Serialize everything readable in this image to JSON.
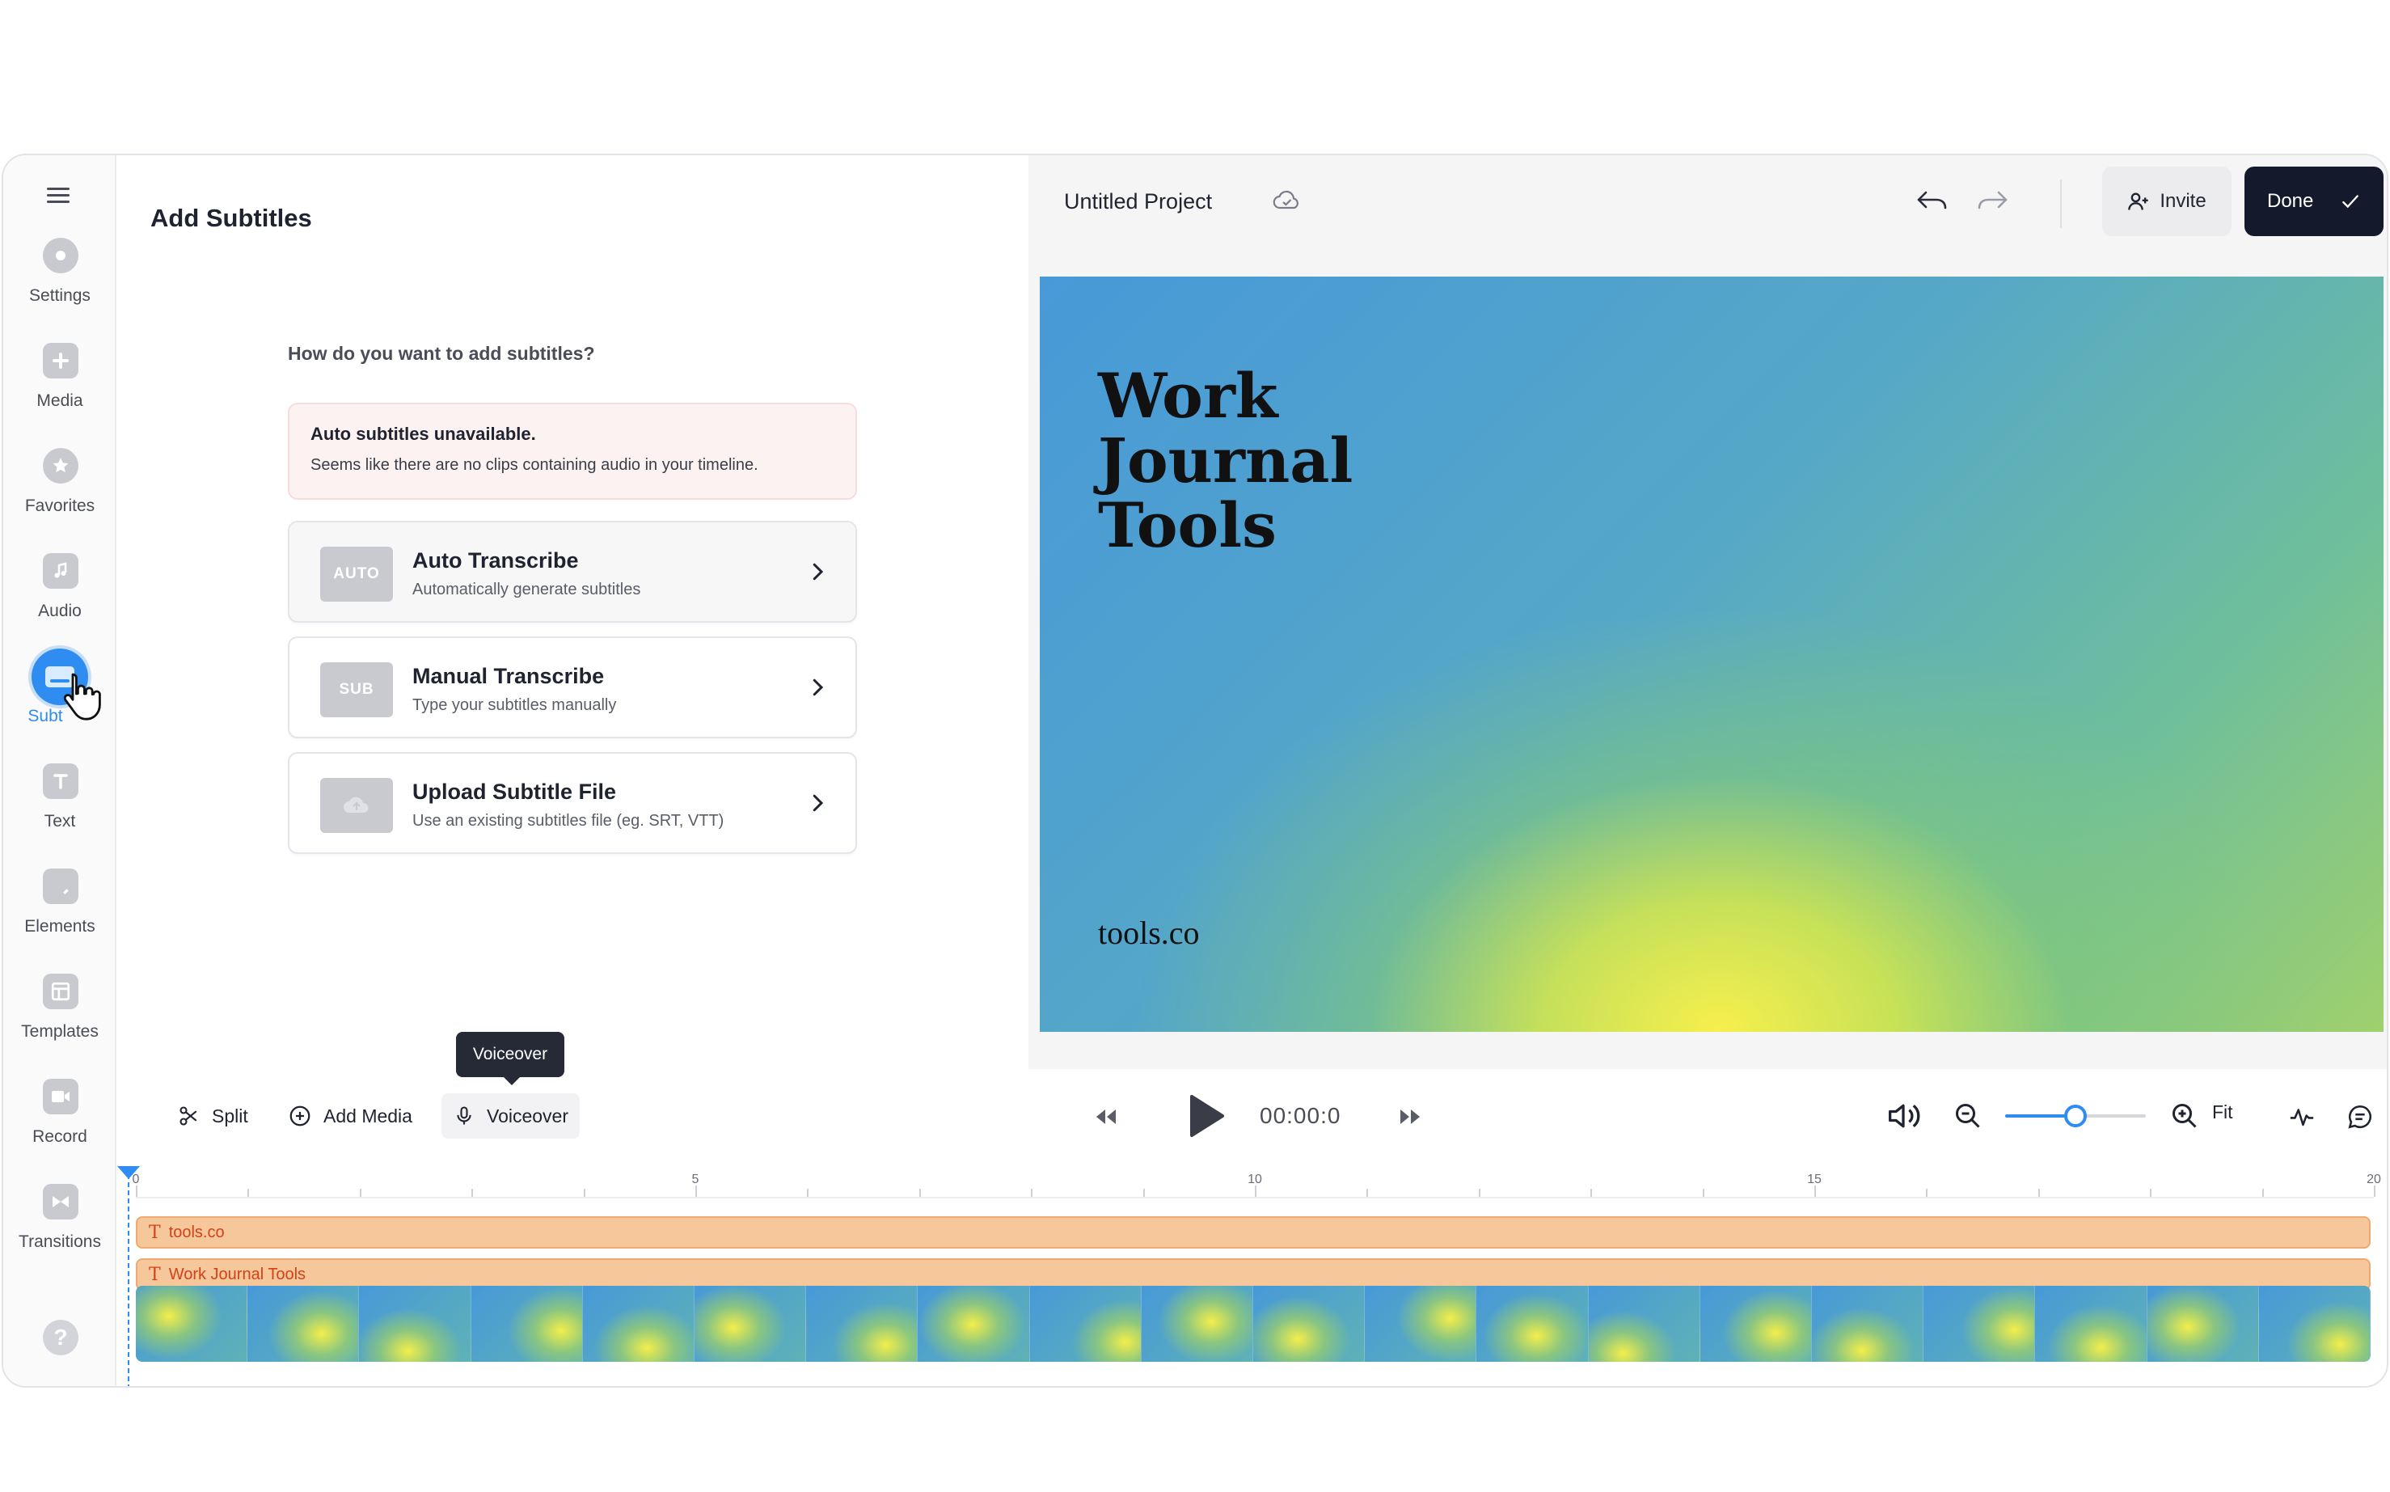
{
  "rail": {
    "items": [
      {
        "label": "Settings",
        "icon": "gear-icon"
      },
      {
        "label": "Media",
        "icon": "plus-icon"
      },
      {
        "label": "Favorites",
        "icon": "star-icon"
      },
      {
        "label": "Audio",
        "icon": "music-note-icon"
      },
      {
        "label": "Subtitles",
        "icon": "subtitles-icon"
      },
      {
        "label": "Text",
        "icon": "text-icon"
      },
      {
        "label": "Elements",
        "icon": "sticker-icon"
      },
      {
        "label": "Templates",
        "icon": "template-icon"
      },
      {
        "label": "Record",
        "icon": "camera-icon"
      },
      {
        "label": "Transitions",
        "icon": "transition-icon"
      }
    ],
    "active_visible_label": "Subt",
    "help": "?"
  },
  "panel": {
    "title": "Add Subtitles",
    "question": "How do you want to add subtitles?",
    "warning": {
      "title": "Auto subtitles unavailable.",
      "message": "Seems like there are no clips containing audio in your timeline."
    },
    "options": [
      {
        "badge": "AUTO",
        "title": "Auto Transcribe",
        "subtitle": "Automatically generate subtitles"
      },
      {
        "badge": "SUB",
        "title": "Manual Transcribe",
        "subtitle": "Type your subtitles manually"
      },
      {
        "badge": "",
        "title": "Upload Subtitle File",
        "subtitle": "Use an existing subtitles file (eg. SRT, VTT)"
      }
    ]
  },
  "header": {
    "project_name": "Untitled Project",
    "invite_label": "Invite",
    "done_label": "Done"
  },
  "preview": {
    "title_lines": [
      "Work",
      "Journal",
      "Tools"
    ],
    "url": "tools.co"
  },
  "toolbar": {
    "split_label": "Split",
    "add_media_label": "Add Media",
    "voiceover_label": "Voiceover",
    "tooltip": "Voiceover",
    "time": "00:00:0",
    "fit_label": "Fit",
    "zoom_level": 0.5
  },
  "timeline": {
    "ruler_labels": [
      "0",
      "5",
      "10",
      "15",
      "20"
    ],
    "ruler_max": 20,
    "tracks": [
      {
        "label": "tools.co"
      },
      {
        "label": "Work Journal Tools"
      }
    ],
    "frame_count": 20
  },
  "colors": {
    "accent": "#2f8cf0",
    "done_button": "#141a2b",
    "text_track": "#f6c79b",
    "text_track_label": "#d2421a"
  }
}
